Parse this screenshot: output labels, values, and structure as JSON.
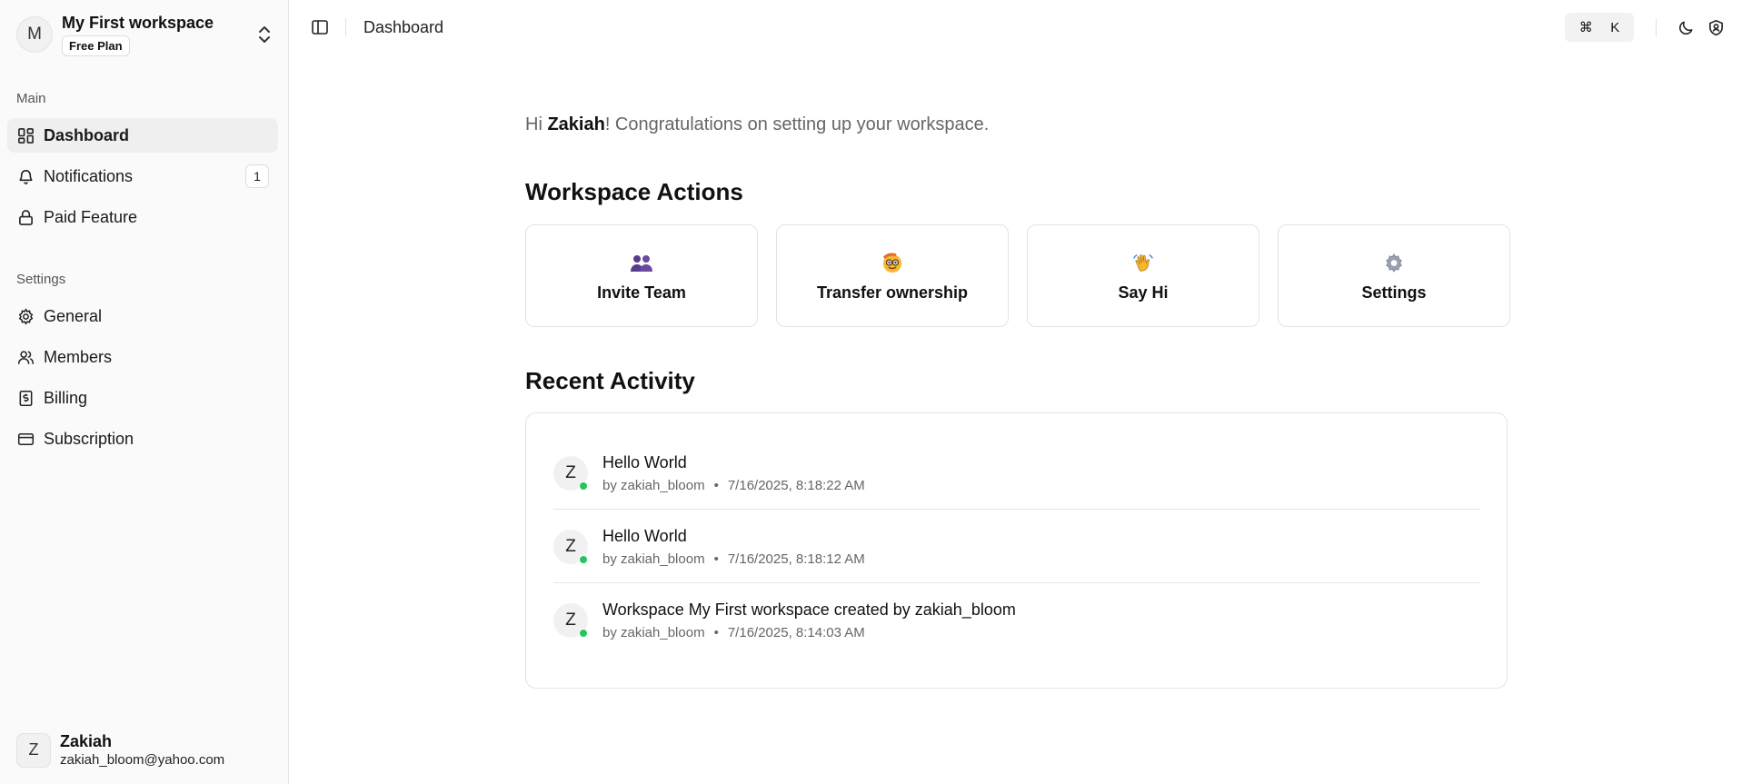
{
  "workspace": {
    "avatar_letter": "M",
    "name": "My First workspace",
    "plan": "Free Plan"
  },
  "nav": {
    "main_label": "Main",
    "main_items": [
      {
        "label": "Dashboard",
        "icon": "dashboard-icon"
      },
      {
        "label": "Notifications",
        "icon": "bell-icon",
        "count": "1"
      },
      {
        "label": "Paid Feature",
        "icon": "lock-icon"
      }
    ],
    "settings_label": "Settings",
    "settings_items": [
      {
        "label": "General",
        "icon": "gear-icon"
      },
      {
        "label": "Members",
        "icon": "users-icon"
      },
      {
        "label": "Billing",
        "icon": "receipt-icon"
      },
      {
        "label": "Subscription",
        "icon": "credit-card-icon"
      }
    ]
  },
  "user": {
    "avatar_letter": "Z",
    "name": "Zakiah",
    "email": "zakiah_bloom@yahoo.com"
  },
  "topbar": {
    "breadcrumb": "Dashboard",
    "shortcut_symbol": "⌘",
    "shortcut_key": "K"
  },
  "main": {
    "greeting_prefix": "Hi ",
    "greeting_name": "Zakiah",
    "greeting_suffix": "! Congratulations on setting up your workspace.",
    "actions_title": "Workspace Actions",
    "actions": [
      {
        "label": "Invite Team",
        "emoji": "👥"
      },
      {
        "label": "Transfer ownership",
        "emoji": "🤓"
      },
      {
        "label": "Say Hi",
        "emoji": "👋"
      },
      {
        "label": "Settings",
        "emoji": "⚙️"
      }
    ],
    "activity_title": "Recent Activity",
    "activities": [
      {
        "avatar": "Z",
        "title": "Hello World",
        "by": "by zakiah_bloom",
        "time": "7/16/2025, 8:18:22 AM"
      },
      {
        "avatar": "Z",
        "title": "Hello World",
        "by": "by zakiah_bloom",
        "time": "7/16/2025, 8:18:12 AM"
      },
      {
        "avatar": "Z",
        "title": "Workspace My First workspace created by zakiah_bloom",
        "by": "by zakiah_bloom",
        "time": "7/16/2025, 8:14:03 AM"
      }
    ]
  },
  "colors": {
    "online": "#22c55e",
    "sidebar_bg": "#fafafa",
    "active_bg": "#efefef"
  }
}
